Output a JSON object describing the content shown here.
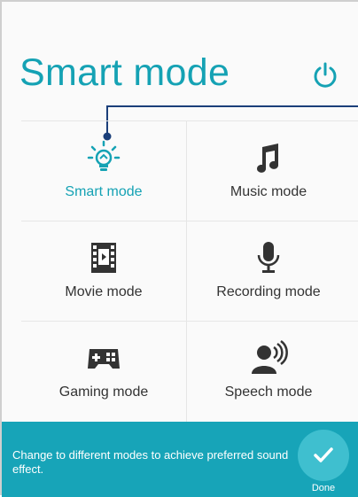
{
  "header": {
    "title": "Smart mode",
    "power_icon": "power-icon"
  },
  "modes": [
    {
      "label": "Smart mode",
      "icon": "lightbulb-icon",
      "active": true
    },
    {
      "label": "Music mode",
      "icon": "music-note-icon",
      "active": false
    },
    {
      "label": "Movie mode",
      "icon": "film-icon",
      "active": false
    },
    {
      "label": "Recording mode",
      "icon": "microphone-icon",
      "active": false
    },
    {
      "label": "Gaming mode",
      "icon": "gamepad-icon",
      "active": false
    },
    {
      "label": "Speech mode",
      "icon": "speaker-person-icon",
      "active": false
    }
  ],
  "footer": {
    "hint": "Change to different modes to achieve preferred sound effect.",
    "done_label": "Done",
    "done_icon": "check-icon"
  },
  "colors": {
    "accent": "#15a2b4",
    "footer_bg": "#17a4b8",
    "done_button": "#3fbfcf",
    "icon": "#333333"
  }
}
